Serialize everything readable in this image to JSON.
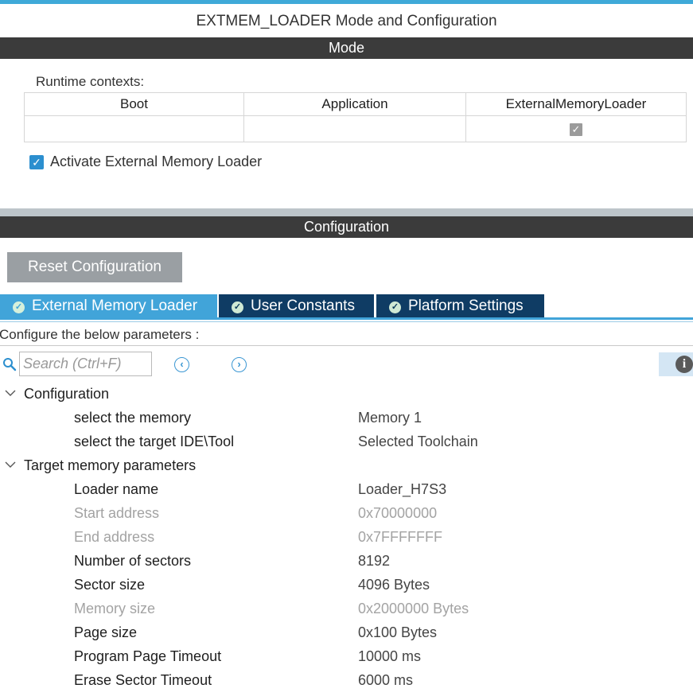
{
  "window_title": "EXTMEM_LOADER Mode and Configuration",
  "mode": {
    "header": "Mode",
    "runtime_label": "Runtime contexts:",
    "columns": [
      "Boot",
      "Application",
      "ExternalMemoryLoader"
    ],
    "checked_column": "ExternalMemoryLoader",
    "activate_label": "Activate External Memory Loader",
    "activate_checked": true
  },
  "configuration": {
    "header": "Configuration",
    "reset_label": "Reset Configuration",
    "tabs": [
      {
        "label": "External Memory Loader",
        "active": true
      },
      {
        "label": "User Constants",
        "active": false
      },
      {
        "label": "Platform Settings",
        "active": false
      }
    ],
    "configure_hint": "Configure the below parameters :",
    "search_placeholder": "Search (Ctrl+F)",
    "groups": [
      {
        "label": "Configuration",
        "params": [
          {
            "name": "select the memory",
            "value": "Memory 1",
            "enabled": true
          },
          {
            "name": "select the target IDE\\Tool",
            "value": "Selected Toolchain",
            "enabled": true
          }
        ]
      },
      {
        "label": "Target memory parameters",
        "params": [
          {
            "name": "Loader name",
            "value": "Loader_H7S3",
            "enabled": true
          },
          {
            "name": "Start address",
            "value": "0x70000000",
            "enabled": false
          },
          {
            "name": "End address",
            "value": "0x7FFFFFFF",
            "enabled": false
          },
          {
            "name": "Number of sectors",
            "value": "8192",
            "enabled": true
          },
          {
            "name": "Sector size",
            "value": "4096 Bytes",
            "enabled": true
          },
          {
            "name": "Memory size",
            "value": "0x2000000 Bytes",
            "enabled": false
          },
          {
            "name": "Page size",
            "value": "0x100 Bytes",
            "enabled": true
          },
          {
            "name": "Program Page Timeout",
            "value": "10000 ms",
            "enabled": true
          },
          {
            "name": "Erase Sector Timeout",
            "value": "6000 ms",
            "enabled": true
          }
        ]
      }
    ]
  },
  "colors": {
    "accent": "#41a4d9",
    "tab_inactive": "#0f3c64",
    "section_bar": "#3b3b3b",
    "checkbox": "#2c8fcf",
    "disabled_text": "#a3a3a3"
  }
}
